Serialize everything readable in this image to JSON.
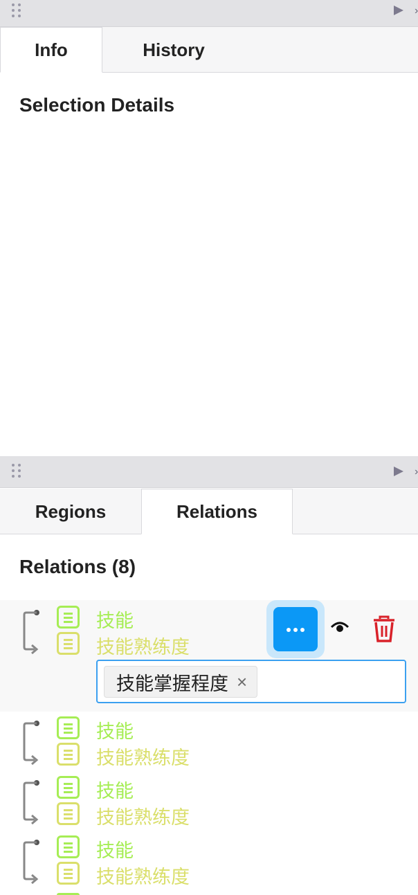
{
  "top_panel": {
    "tabs": [
      "Info",
      "History"
    ],
    "active_tab": "Info",
    "section_title": "Selection Details"
  },
  "bottom_panel": {
    "tabs": [
      "Regions",
      "Relations"
    ],
    "active_tab": "Relations",
    "section_title": "Relations (8)",
    "relations": [
      {
        "from": "技能",
        "to": "技能熟练度",
        "selected": true,
        "tag": "技能掌握程度"
      },
      {
        "from": "技能",
        "to": "技能熟练度"
      },
      {
        "from": "技能",
        "to": "技能熟练度"
      },
      {
        "from": "技能",
        "to": "技能熟练度"
      }
    ]
  },
  "colors": {
    "from_label": "#a6ed55",
    "to_label": "#dadf6b",
    "accent": "#0b98f6",
    "delete": "#d9222a",
    "header_bg": "#e2e2e5"
  },
  "icons": [
    "grip-icon",
    "collapse-arrow-icon",
    "relation-arrow-icon",
    "label-icon",
    "more-icon",
    "eye-icon",
    "trash-icon",
    "remove-tag-icon"
  ]
}
